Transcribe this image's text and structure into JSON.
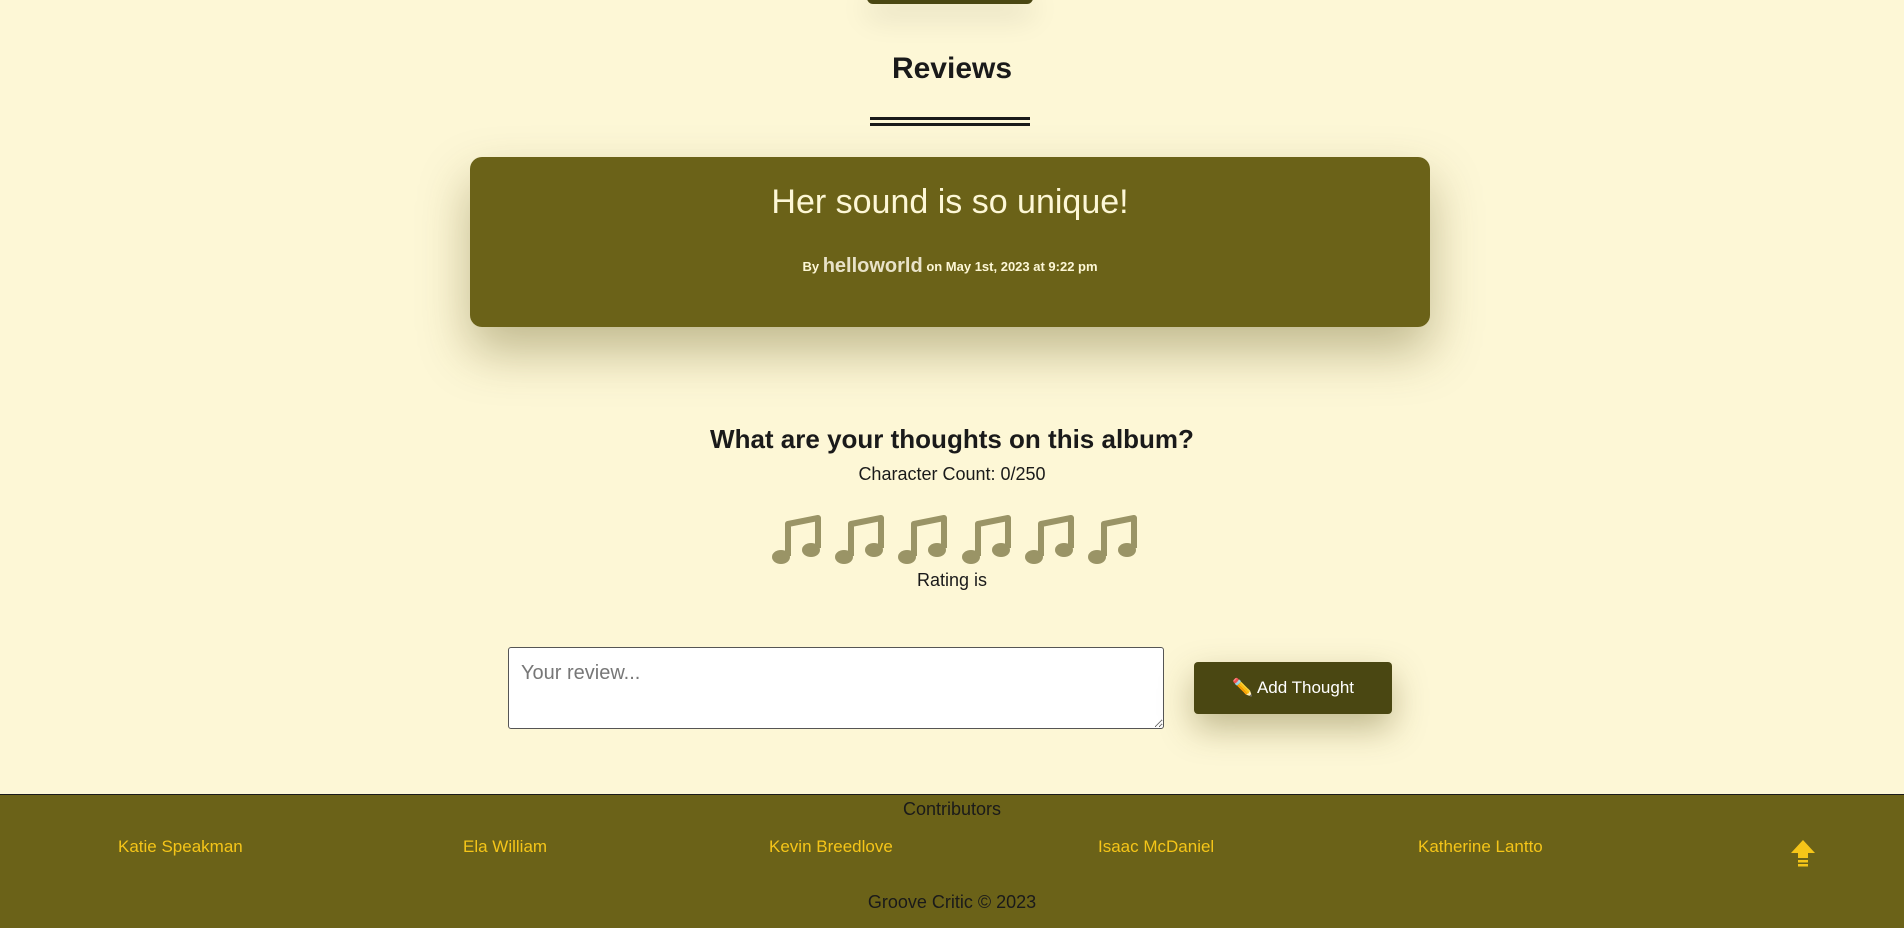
{
  "reviews": {
    "heading": "Reviews",
    "items": [
      {
        "title": "Her sound is so unique!",
        "by": "By",
        "username": "helloworld",
        "date": "on May 1st, 2023 at 9:22 pm"
      }
    ]
  },
  "form": {
    "heading": "What are your thoughts on this album?",
    "char_count": "Character Count: 0/250",
    "rating_label": "Rating is",
    "rating_icon": "music-note-icon",
    "rating_max": 6,
    "rating_value": 0,
    "placeholder": "Your review...",
    "submit_label": "✏️ Add Thought"
  },
  "footer": {
    "contributors_title": "Contributors",
    "contributors": [
      "Katie Speakman",
      "Ela William",
      "Kevin Breedlove",
      "Isaac McDaniel",
      "Katherine Lantto"
    ],
    "copyright": "Groove Critic © 2023",
    "back_to_top_icon": "up-arrow-icon"
  },
  "colors": {
    "background": "#fdf7d6",
    "card": "#6b6218",
    "button": "#4a4712",
    "link": "#f5c518",
    "note": "#9a9466"
  }
}
